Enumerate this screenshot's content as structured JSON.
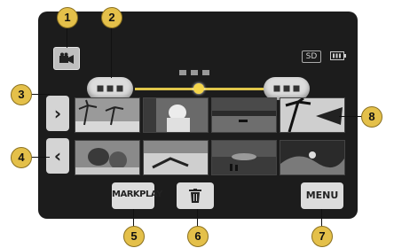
{
  "callouts": [
    "1",
    "2",
    "3",
    "4",
    "5",
    "6",
    "7",
    "8"
  ],
  "status": {
    "sd_label": "SD"
  },
  "buttons": {
    "mark_play_label": "MARKPLAY",
    "menu_label": "MENU"
  },
  "colors": {
    "screen_bg": "#1c1c1c",
    "callout": "#e4c04a",
    "timeline": "#e0c64a",
    "button": "#dcdcdc"
  },
  "icons": [
    "video-camera-icon",
    "battery-icon",
    "chevron-right-icon",
    "chevron-left-icon",
    "trash-icon"
  ],
  "thumbnails": [
    "palm-trees-beach",
    "person-reading",
    "lake-boat",
    "palm-silhouette",
    "people-at-beach",
    "lounge-chair-beach",
    "sunset-shore",
    "surf-wave"
  ]
}
